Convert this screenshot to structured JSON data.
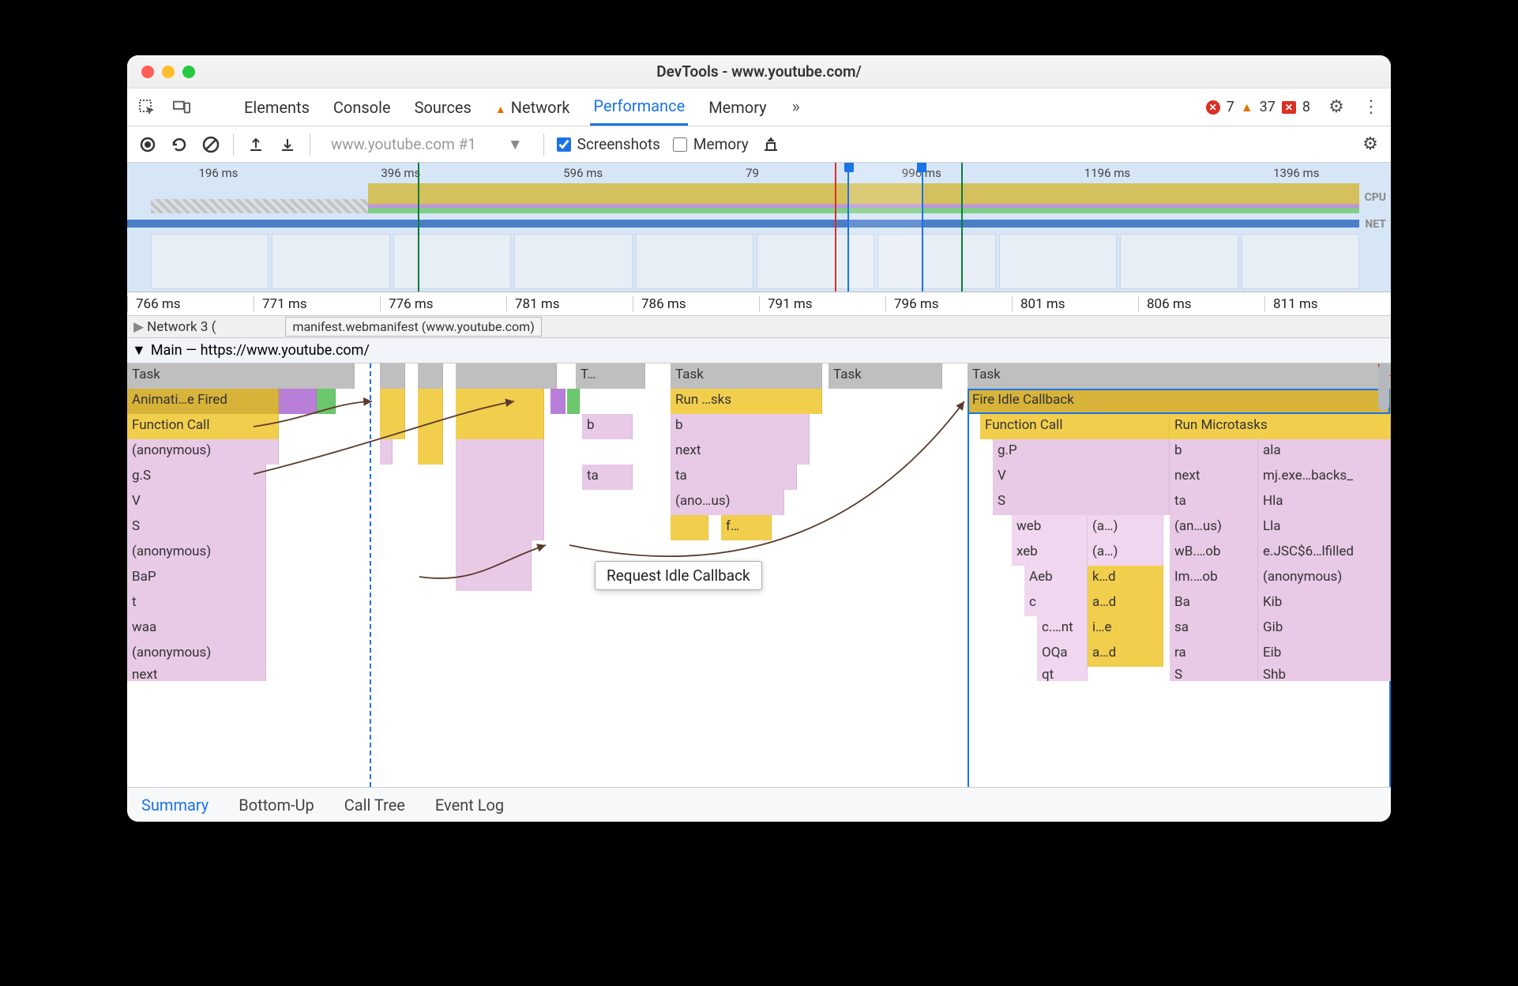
{
  "window": {
    "title": "DevTools - www.youtube.com/"
  },
  "tabs": {
    "elements": "Elements",
    "console": "Console",
    "sources": "Sources",
    "network": "Network",
    "performance": "Performance",
    "memory": "Memory"
  },
  "counts": {
    "errors": "7",
    "warnings": "37",
    "blocked": "8"
  },
  "toolbar": {
    "dropdown": "www.youtube.com #1",
    "screenshots_label": "Screenshots",
    "memory_label": "Memory"
  },
  "overview": {
    "ticks": [
      "196 ms",
      "396 ms",
      "596 ms",
      "79",
      "996 ms",
      "1196 ms",
      "1396 ms"
    ],
    "cpu_label": "CPU",
    "net_label": "NET"
  },
  "ruler": [
    "766 ms",
    "771 ms",
    "776 ms",
    "781 ms",
    "786 ms",
    "791 ms",
    "796 ms",
    "801 ms",
    "806 ms",
    "811 ms"
  ],
  "network_row": {
    "label": "Network 3 (",
    "manifest": "manifest.webmanifest (www.youtube.com)"
  },
  "main_header": "Main — https://www.youtube.com/",
  "flame": {
    "r0": {
      "a": "Task",
      "b": "T…",
      "c": "Task",
      "d": "Task",
      "e": "Task"
    },
    "r1": {
      "a": "Animati…e Fired",
      "b": "Run …sks",
      "c": "Fire Idle Callback"
    },
    "r2": {
      "a": "Function Call",
      "b": "b",
      "c": "b",
      "d": "Function Call",
      "e": "Run Microtasks"
    },
    "r3": {
      "a": "(anonymous)",
      "b": "next",
      "c": "g.P",
      "d": "b",
      "e": "ala"
    },
    "r4": {
      "a": "g.S",
      "b": "ta",
      "c": "ta",
      "d": "V",
      "e": "next",
      "f": "mj.exe…backs_"
    },
    "r5": {
      "a": "V",
      "b": "(ano…us)",
      "c": "S",
      "d": "ta",
      "e": "Hla"
    },
    "r6": {
      "a": "S",
      "b": "f…",
      "c": "web",
      "d": "(a…)",
      "e": "(an…us)",
      "f": "Lla"
    },
    "r7": {
      "a": "(anonymous)",
      "b": "xeb",
      "c": "(a…)",
      "d": "wB.…ob",
      "e": "e.JSC$6…lfilled"
    },
    "r8": {
      "a": "BaP",
      "b": "Aeb",
      "c": "k…d",
      "d": "Im.…ob",
      "e": "(anonymous)"
    },
    "r9": {
      "a": "t",
      "b": "c",
      "c": "a…d",
      "d": "Ba",
      "e": "Kib"
    },
    "r10": {
      "a": "waa",
      "b": "c.…nt",
      "c": "i…e",
      "d": "sa",
      "e": "Gib"
    },
    "r11": {
      "a": "(anonymous)",
      "b": "OQa",
      "c": "a…d",
      "d": "ra",
      "e": "Eib"
    },
    "r12": {
      "a": "next",
      "b": "qt",
      "c": "S",
      "d": "Shb"
    }
  },
  "tooltip": "Request Idle Callback",
  "bottom_tabs": {
    "summary": "Summary",
    "bottomup": "Bottom-Up",
    "calltree": "Call Tree",
    "eventlog": "Event Log"
  }
}
